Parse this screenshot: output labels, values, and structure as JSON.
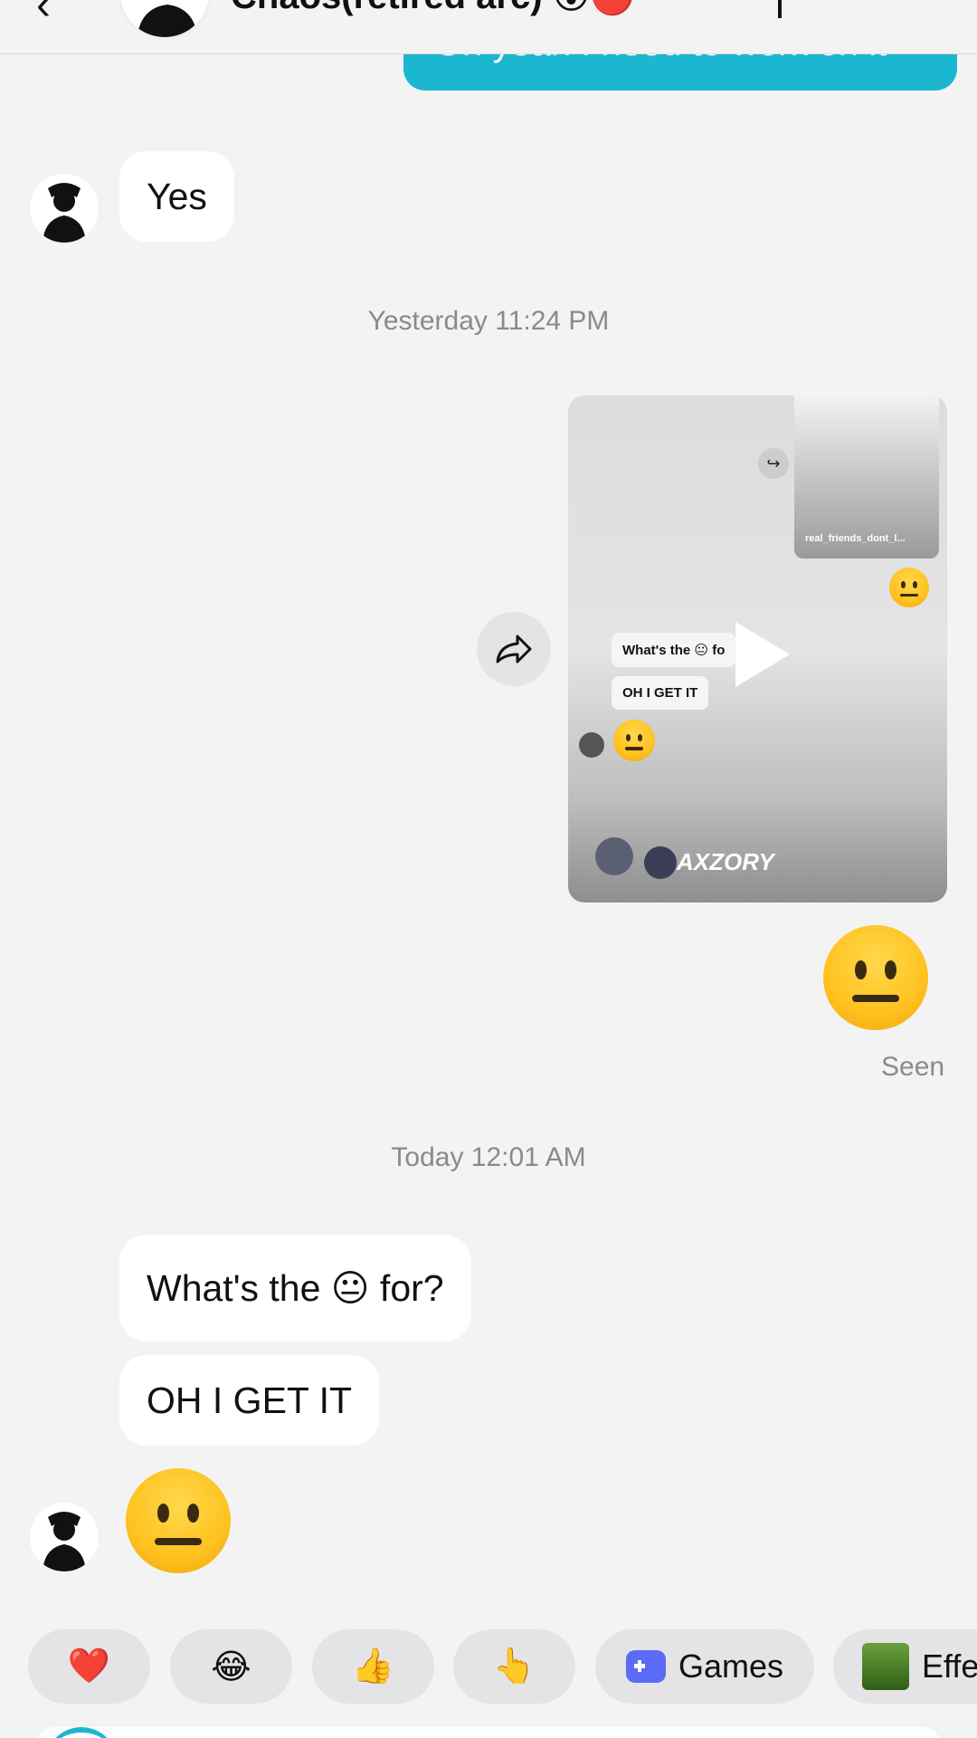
{
  "header": {
    "back_icon": "chevron-left-icon",
    "contact_name": "Chaos(retired arc) 😲🔴"
  },
  "messages": {
    "outgoing_partial": "Oh yeah I need to work on it",
    "reply_yes": "Yes",
    "timestamp_1": "Yesterday 11:24 PM",
    "video_card": {
      "mini_text_1": "What's the 😐 fo",
      "mini_text_2": "OH I GET IT",
      "thumb_user": "real_friends_dont_l...",
      "username": "AXZORY"
    },
    "big_emoji": "😐",
    "seen": "Seen",
    "timestamp_2": "Today 12:01 AM",
    "incoming_1": "What's the 😐 for?",
    "incoming_2": "OH I GET IT",
    "incoming_emoji": "😐"
  },
  "quick_reactions": [
    {
      "icon": "heart-icon",
      "glyph": "❤️"
    },
    {
      "icon": "laughing-icon",
      "glyph": "😂"
    },
    {
      "icon": "thumbs-up-icon",
      "glyph": "👍"
    },
    {
      "icon": "pointing-hand-icon",
      "glyph": "👆"
    },
    {
      "icon": "gamepad-icon",
      "label": "Games"
    },
    {
      "icon": "effects-icon",
      "label": "Effe"
    }
  ],
  "colors": {
    "accent": "#1bb7d1",
    "background": "#f3f3f4",
    "bubble_in": "#ffffff"
  }
}
